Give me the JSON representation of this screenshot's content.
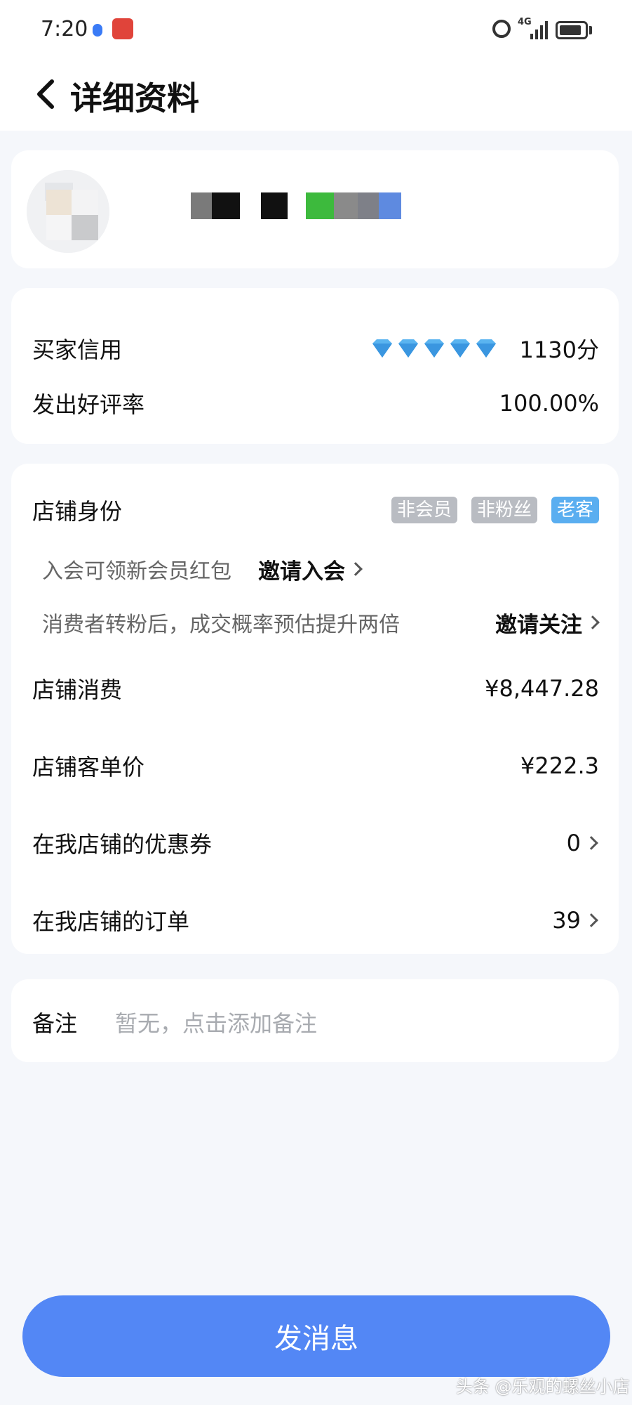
{
  "status_bar": {
    "time": "7:20",
    "network": "4G"
  },
  "header": {
    "title": "详细资料"
  },
  "credit": {
    "buyer_credit_label": "买家信用",
    "buyer_credit_value": "1130分",
    "diamond_count": 5,
    "good_review_label": "发出好评率",
    "good_review_value": "100.00%"
  },
  "shop": {
    "identity_label": "店铺身份",
    "tags": [
      "非会员",
      "非粉丝",
      "老客"
    ],
    "member_hint": "入会可领新会员红包",
    "member_action": "邀请入会",
    "fan_hint": "消费者转粉后，成交概率预估提升两倍",
    "fan_action": "邀请关注",
    "spend_label": "店铺消费",
    "spend_value": "¥8,447.28",
    "avg_price_label": "店铺客单价",
    "avg_price_value": "¥222.3",
    "coupon_label": "在我店铺的优惠券",
    "coupon_value": "0",
    "orders_label": "在我店铺的订单",
    "orders_value": "39"
  },
  "note": {
    "label": "备注",
    "placeholder": "暂无，点击添加备注"
  },
  "send_button": "发消息",
  "watermark": "头条 @乐观的螺丝小店",
  "colors": {
    "accent": "#5387f5",
    "tag_gray": "#b9bcc2",
    "tag_blue": "#5aaef0",
    "background": "#f5f7fb"
  }
}
